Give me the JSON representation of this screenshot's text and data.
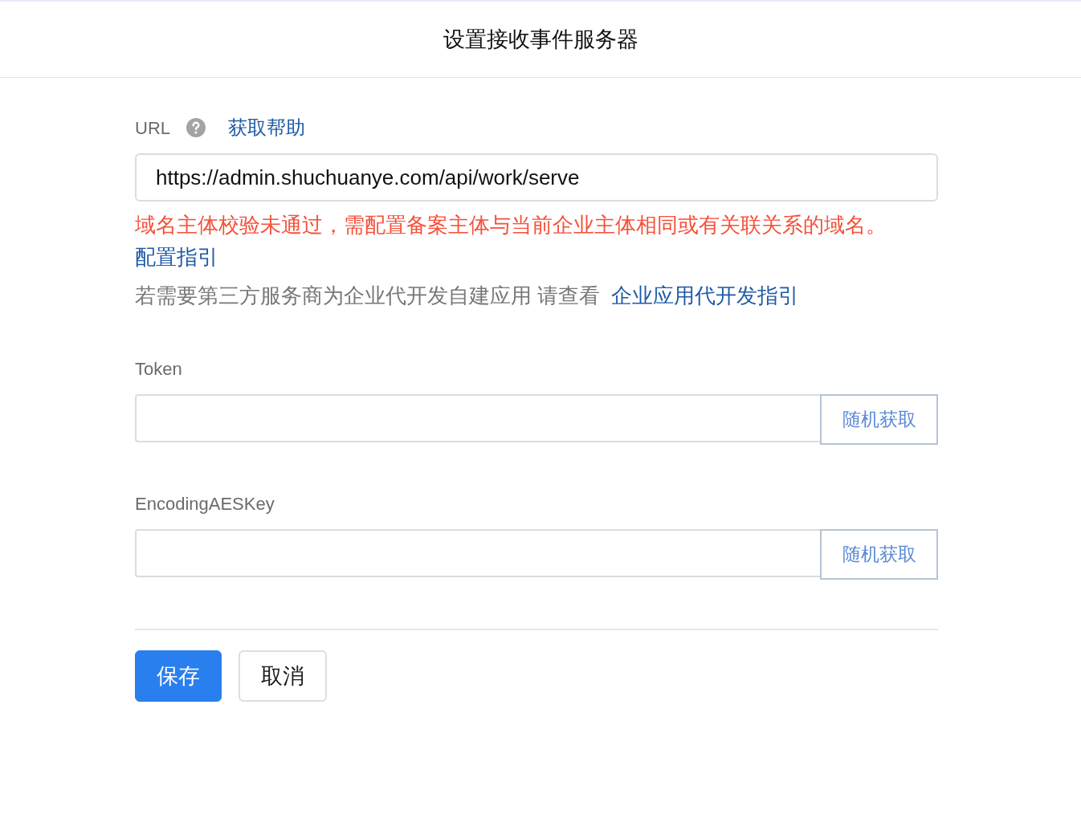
{
  "header": {
    "title": "设置接收事件服务器"
  },
  "url_field": {
    "label": "URL",
    "help_link": "获取帮助",
    "value": "https://admin.shuchuanye.com/api/work/serve",
    "error": "域名主体校验未通过，需配置备案主体与当前企业主体相同或有关联关系的域名。",
    "error_link": "配置指引",
    "hint": "若需要第三方服务商为企业代开发自建应用 请查看",
    "hint_link": "企业应用代开发指引"
  },
  "key_fields": [
    {
      "label": "Token",
      "button": "随机获取"
    },
    {
      "label": "EncodingAESKey",
      "button": "随机获取"
    }
  ],
  "actions": [
    {
      "label": "保存",
      "kind": "primary"
    },
    {
      "label": "取消",
      "kind": "secondary"
    }
  ]
}
